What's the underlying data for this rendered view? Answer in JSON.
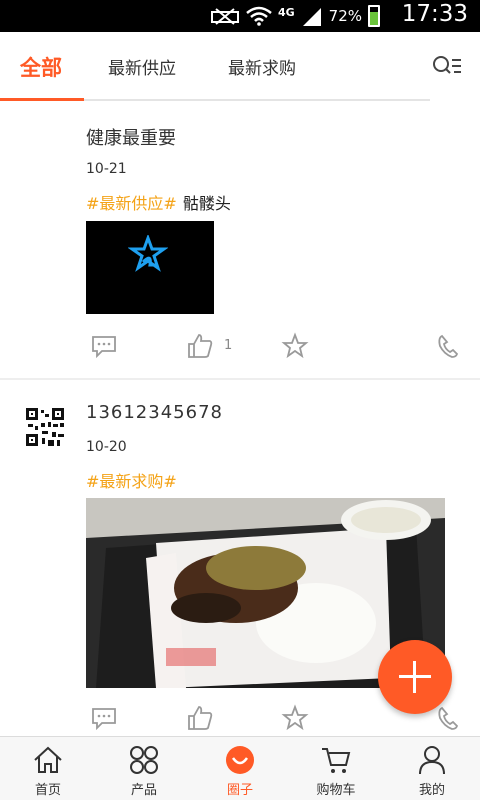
{
  "status_bar": {
    "battery_percent": "72%",
    "network": "4G",
    "time": "17:33"
  },
  "tabs": [
    {
      "label": "全部",
      "active": true
    },
    {
      "label": "最新供应",
      "active": false
    },
    {
      "label": "最新求购",
      "active": false
    }
  ],
  "posts": [
    {
      "title": "健康最重要",
      "date": "10-21",
      "tag": "#最新供应#",
      "tag_text": "骷髅头",
      "likes": "1"
    },
    {
      "title": "13612345678",
      "date": "10-20",
      "tag": "#最新求购#",
      "tag_text": "",
      "likes": ""
    }
  ],
  "bottom_nav": [
    {
      "label": "首页",
      "icon": "home-icon"
    },
    {
      "label": "产品",
      "icon": "product-grid-icon"
    },
    {
      "label": "圈子",
      "icon": "circle-smile-icon",
      "active": true
    },
    {
      "label": "购物车",
      "icon": "cart-icon"
    },
    {
      "label": "我的",
      "icon": "person-icon"
    }
  ],
  "colors": {
    "accent": "#ff5a26",
    "tag": "#f4a318"
  }
}
